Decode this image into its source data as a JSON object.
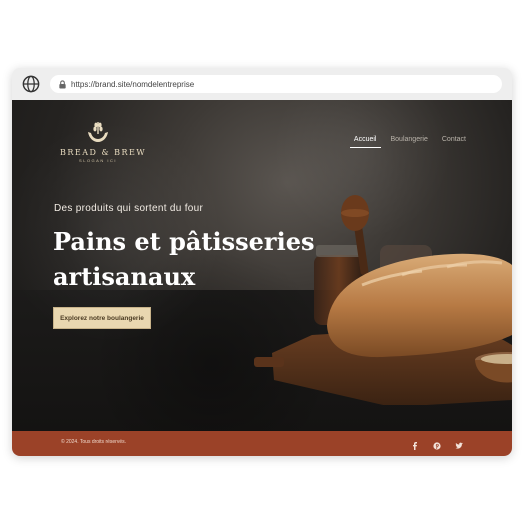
{
  "browser": {
    "url": "https://brand.site/nomdelentreprise",
    "icons": [
      "globe-icon",
      "lock-icon"
    ]
  },
  "brand": {
    "name": "BREAD & BREW",
    "slogan": "SLOGAN ICI",
    "logo_icon": "wheat-hands-icon"
  },
  "nav": {
    "items": [
      {
        "label": "Accueil",
        "active": true
      },
      {
        "label": "Boulangerie",
        "active": false
      },
      {
        "label": "Contact",
        "active": false
      }
    ]
  },
  "hero": {
    "eyebrow": "Des produits qui sortent du four",
    "headline": "Pains et pâtisseries artisanaux",
    "cta_label": "Explorez notre boulangerie"
  },
  "footer": {
    "copyright": "© 2024. Tous droits réservés.",
    "social_icons": [
      "facebook-icon",
      "pinterest-icon",
      "twitter-icon"
    ]
  },
  "colors": {
    "footer_bg": "#9b4228",
    "cta_bg": "#e9d7b0",
    "logo": "#e9dcc0"
  }
}
